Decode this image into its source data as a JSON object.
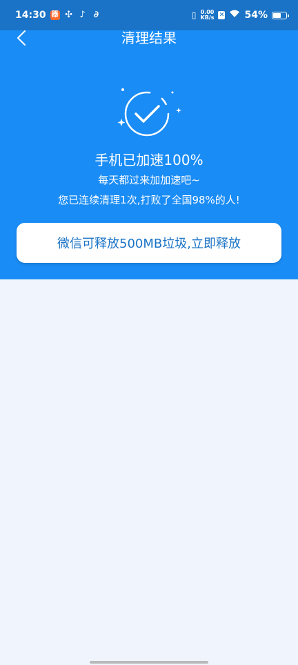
{
  "status_bar": {
    "time": "14:30",
    "notif_1": "器",
    "net_speed_top": "0.00",
    "net_speed_bottom": "KB/s",
    "battery": "54%"
  },
  "header": {
    "title": "清理结果"
  },
  "result": {
    "headline": "手机已加速100%",
    "subline": "每天都过来加加速吧~",
    "stats": "您已连续清理1次,打败了全国98%的人!"
  },
  "action": {
    "label": "微信可释放500MB垃圾,立即释放"
  },
  "colors": {
    "hero_bg": "#1a8cf5",
    "status_bg": "#1a73c6",
    "page_bg": "#f0f5fd",
    "button_text": "#1a73c6"
  }
}
